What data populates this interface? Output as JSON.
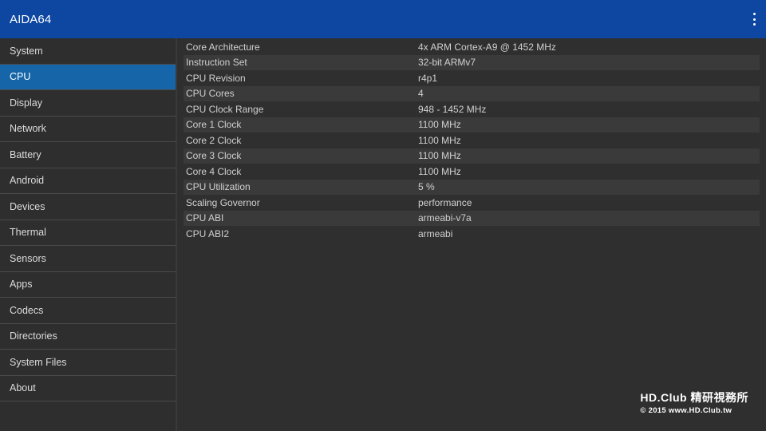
{
  "appbar": {
    "title": "AIDA64",
    "menu_icon": "more-vert-icon"
  },
  "sidebar": {
    "items": [
      {
        "label": "System"
      },
      {
        "label": "CPU",
        "active": true
      },
      {
        "label": "Display"
      },
      {
        "label": "Network"
      },
      {
        "label": "Battery"
      },
      {
        "label": "Android"
      },
      {
        "label": "Devices"
      },
      {
        "label": "Thermal"
      },
      {
        "label": "Sensors"
      },
      {
        "label": "Apps"
      },
      {
        "label": "Codecs"
      },
      {
        "label": "Directories"
      },
      {
        "label": "System Files"
      },
      {
        "label": "About"
      }
    ]
  },
  "cpu_info": {
    "rows": [
      {
        "key": "Core Architecture",
        "value": "4x ARM Cortex-A9 @ 1452 MHz"
      },
      {
        "key": "Instruction Set",
        "value": "32-bit ARMv7"
      },
      {
        "key": "CPU Revision",
        "value": "r4p1"
      },
      {
        "key": "CPU Cores",
        "value": "4"
      },
      {
        "key": "CPU Clock Range",
        "value": "948 - 1452 MHz"
      },
      {
        "key": "Core 1 Clock",
        "value": "1100 MHz"
      },
      {
        "key": "Core 2 Clock",
        "value": "1100 MHz"
      },
      {
        "key": "Core 3 Clock",
        "value": "1100 MHz"
      },
      {
        "key": "Core 4 Clock",
        "value": "1100 MHz"
      },
      {
        "key": "CPU Utilization",
        "value": "5 %"
      },
      {
        "key": "Scaling Governor",
        "value": "performance"
      },
      {
        "key": "CPU ABI",
        "value": "armeabi-v7a"
      },
      {
        "key": "CPU ABI2",
        "value": "armeabi"
      }
    ]
  },
  "watermark": {
    "line1": "HD.Club 精研視務所",
    "line2": "© 2015  www.HD.Club.tw"
  },
  "colors": {
    "appbar": "#0d47a1",
    "active_item": "#1565a8",
    "background": "#2e2e2e"
  }
}
